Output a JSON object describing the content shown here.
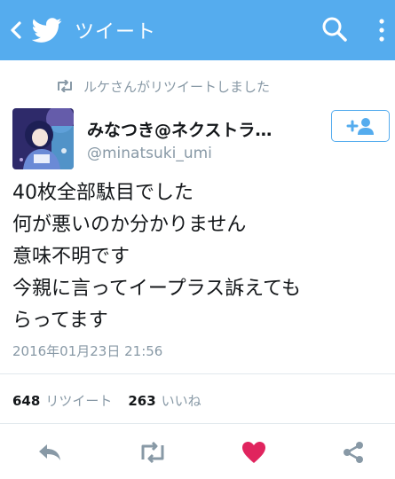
{
  "header": {
    "title": "ツイート",
    "back_icon": "back-chevron-icon",
    "logo_icon": "twitter-bird-icon",
    "search_icon": "search-icon",
    "menu_icon": "overflow-menu-icon",
    "bar_color": "#55acee"
  },
  "retweet_context": {
    "text": "ルケさんがリツイートしました",
    "icon": "retweet-icon"
  },
  "author": {
    "display_name": "みなつき@ネクストラ…",
    "handle": "@minatsuki_umi",
    "follow_icon": "follow-user-icon"
  },
  "tweet": {
    "lines": [
      "40枚全部駄目でした",
      "何が悪いのか分かりません",
      "意味不明です",
      "今親に言ってイープラス訴えても",
      "らってます"
    ],
    "timestamp": "2016年01月23日 21:56"
  },
  "stats": {
    "retweets_count": "648",
    "retweets_label": "リツイート",
    "likes_count": "263",
    "likes_label": "いいね"
  },
  "actions": {
    "reply_icon": "reply-icon",
    "retweet_icon": "retweet-icon",
    "like_icon": "heart-icon",
    "share_icon": "share-icon",
    "like_color": "#e0245e"
  }
}
